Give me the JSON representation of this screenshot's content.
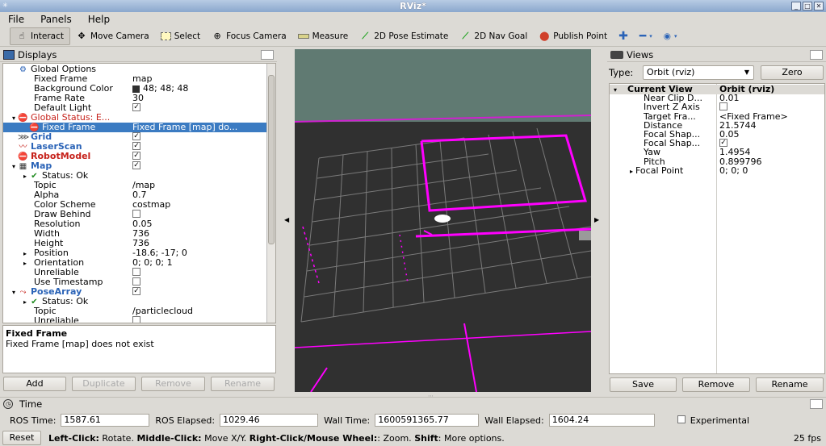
{
  "window": {
    "title": "RViz*"
  },
  "menu": [
    "File",
    "Panels",
    "Help"
  ],
  "toolbar": {
    "tools": [
      {
        "label": "Interact",
        "icon": "hand-icon",
        "active": true
      },
      {
        "label": "Move Camera",
        "icon": "move-icon"
      },
      {
        "label": "Select",
        "icon": "select-icon"
      },
      {
        "label": "Focus Camera",
        "icon": "focus-icon"
      },
      {
        "label": "Measure",
        "icon": "ruler-icon"
      },
      {
        "label": "2D Pose Estimate",
        "icon": "green-arrow-icon"
      },
      {
        "label": "2D Nav Goal",
        "icon": "green-arrow-icon"
      },
      {
        "label": "Publish Point",
        "icon": "pin-icon"
      }
    ]
  },
  "displays": {
    "title": "Displays",
    "rows": [
      {
        "indent": 0,
        "arrow": "",
        "icon": "gear",
        "name": "Global Options",
        "value": "",
        "style": ""
      },
      {
        "indent": 1,
        "arrow": "",
        "icon": "",
        "name": "Fixed Frame",
        "value": "map",
        "style": ""
      },
      {
        "indent": 1,
        "arrow": "",
        "icon": "",
        "name": "Background Color",
        "value": "48; 48; 48",
        "swatch": "#303030",
        "style": ""
      },
      {
        "indent": 1,
        "arrow": "",
        "icon": "",
        "name": "Frame Rate",
        "value": "30",
        "style": ""
      },
      {
        "indent": 1,
        "arrow": "",
        "icon": "",
        "name": "Default Light",
        "check": true,
        "style": ""
      },
      {
        "indent": 0,
        "arrow": "▾",
        "icon": "error",
        "name": "Global Status: E...",
        "value": "",
        "style": "red-normal"
      },
      {
        "indent": 1,
        "arrow": "",
        "icon": "error",
        "name": "Fixed Frame",
        "value": "Fixed Frame [map] do...",
        "style": "",
        "selected": true
      },
      {
        "indent": 0,
        "arrow": "",
        "icon": "grid",
        "name": "Grid",
        "check": true,
        "style": "blue"
      },
      {
        "indent": 0,
        "arrow": "",
        "icon": "laser",
        "name": "LaserScan",
        "check": true,
        "style": "blue"
      },
      {
        "indent": 0,
        "arrow": "",
        "icon": "error",
        "name": "RobotModel",
        "check": true,
        "style": "red"
      },
      {
        "indent": 0,
        "arrow": "▾",
        "icon": "map",
        "name": "Map",
        "check": true,
        "style": "blue"
      },
      {
        "indent": 1,
        "arrow": "▸",
        "icon": "ok",
        "name": "Status: Ok",
        "value": "",
        "style": ""
      },
      {
        "indent": 1,
        "arrow": "",
        "icon": "",
        "name": "Topic",
        "value": "/map",
        "style": ""
      },
      {
        "indent": 1,
        "arrow": "",
        "icon": "",
        "name": "Alpha",
        "value": "0.7",
        "style": ""
      },
      {
        "indent": 1,
        "arrow": "",
        "icon": "",
        "name": "Color Scheme",
        "value": "costmap",
        "style": ""
      },
      {
        "indent": 1,
        "arrow": "",
        "icon": "",
        "name": "Draw Behind",
        "check": false,
        "style": ""
      },
      {
        "indent": 1,
        "arrow": "",
        "icon": "",
        "name": "Resolution",
        "value": "0.05",
        "style": ""
      },
      {
        "indent": 1,
        "arrow": "",
        "icon": "",
        "name": "Width",
        "value": "736",
        "style": ""
      },
      {
        "indent": 1,
        "arrow": "",
        "icon": "",
        "name": "Height",
        "value": "736",
        "style": ""
      },
      {
        "indent": 1,
        "arrow": "▸",
        "icon": "",
        "name": "Position",
        "value": "-18.6; -17; 0",
        "style": ""
      },
      {
        "indent": 1,
        "arrow": "▸",
        "icon": "",
        "name": "Orientation",
        "value": "0; 0; 0; 1",
        "style": ""
      },
      {
        "indent": 1,
        "arrow": "",
        "icon": "",
        "name": "Unreliable",
        "check": false,
        "style": ""
      },
      {
        "indent": 1,
        "arrow": "",
        "icon": "",
        "name": "Use Timestamp",
        "check": false,
        "style": ""
      },
      {
        "indent": 0,
        "arrow": "▾",
        "icon": "pose",
        "name": "PoseArray",
        "check": true,
        "style": "blue"
      },
      {
        "indent": 1,
        "arrow": "▸",
        "icon": "ok",
        "name": "Status: Ok",
        "value": "",
        "style": ""
      },
      {
        "indent": 1,
        "arrow": "",
        "icon": "",
        "name": "Topic",
        "value": "/particlecloud",
        "style": ""
      },
      {
        "indent": 1,
        "arrow": "",
        "icon": "",
        "name": "Unreliable",
        "check": false,
        "style": ""
      }
    ],
    "description_title": "Fixed Frame",
    "description_text": "Fixed Frame [map] does not exist",
    "buttons": {
      "add": "Add",
      "duplicate": "Duplicate",
      "remove": "Remove",
      "rename": "Rename"
    }
  },
  "views": {
    "title": "Views",
    "type_label": "Type:",
    "type_value": "Orbit (rviz)",
    "zero": "Zero",
    "rows": [
      {
        "name": "Current View",
        "value": "Orbit (rviz)",
        "header": true,
        "arrow": "▾"
      },
      {
        "name": "Near Clip D...",
        "value": "0.01"
      },
      {
        "name": "Invert Z Axis",
        "check": false
      },
      {
        "name": "Target Fra...",
        "value": "<Fixed Frame>"
      },
      {
        "name": "Distance",
        "value": "21.5744"
      },
      {
        "name": "Focal Shap...",
        "value": "0.05"
      },
      {
        "name": "Focal Shap...",
        "check": true
      },
      {
        "name": "Yaw",
        "value": "1.4954"
      },
      {
        "name": "Pitch",
        "value": "0.899796"
      },
      {
        "name": "Focal Point",
        "value": "0; 0; 0",
        "arrow": "▸"
      }
    ],
    "buttons": {
      "save": "Save",
      "remove": "Remove",
      "rename": "Rename"
    }
  },
  "time": {
    "title": "Time",
    "ros_time_label": "ROS Time:",
    "ros_time": "1587.61",
    "ros_elapsed_label": "ROS Elapsed:",
    "ros_elapsed": "1029.46",
    "wall_time_label": "Wall Time:",
    "wall_time": "1600591365.77",
    "wall_elapsed_label": "Wall Elapsed:",
    "wall_elapsed": "1604.24",
    "experimental": "Experimental"
  },
  "status": {
    "reset": "Reset",
    "help_html_parts": [
      {
        "b": "Left-Click:",
        "t": " Rotate. "
      },
      {
        "b": "Middle-Click:",
        "t": " Move X/Y. "
      },
      {
        "b": "Right-Click/Mouse Wheel:",
        "t": ": Zoom. "
      },
      {
        "b": "Shift",
        "t": ": More options."
      }
    ],
    "fps": "25 fps"
  },
  "colors": {
    "accent": "#3b7bc2",
    "error": "#c6211a",
    "particle": "#ff00ff",
    "background": "#303030"
  }
}
